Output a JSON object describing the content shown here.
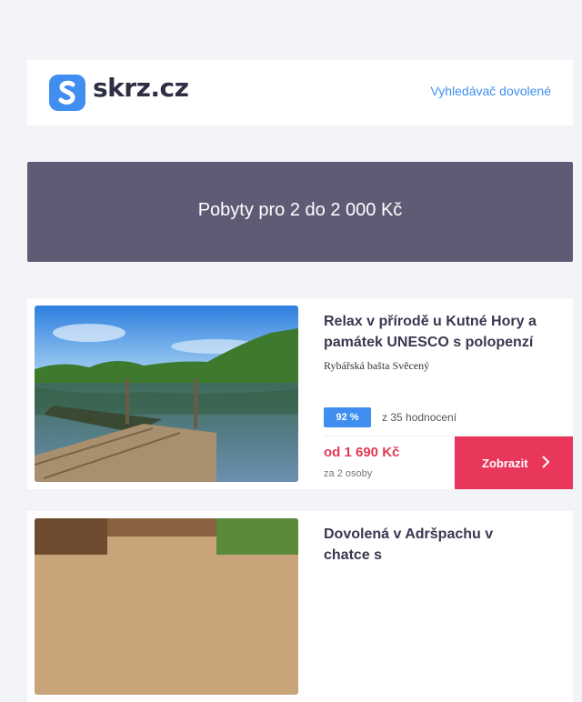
{
  "header": {
    "logo_text": "skrz.cz",
    "link_label": "Vyhledávač dovolené",
    "brand_color": "#3f8ef0",
    "logo_icon": "s-logo-icon"
  },
  "banner": {
    "title": "Pobyty pro 2 do 2 000 Kč",
    "background": "#605b75"
  },
  "offers": [
    {
      "title": "Relax v přírodě u Kutné Hory a památek UNESCO s polopenzí",
      "subtitle": "Rybářská bašta Svěcený",
      "rating": "92 %",
      "reviews": "z 35 hodnocení",
      "price": "od 1 690 Kč",
      "price_note": "za 2 osoby",
      "button_label": "Zobrazit",
      "image": "lake-pier-photo"
    },
    {
      "title": "Dovolená v Adršpachu v chatce s",
      "image": "cabin-terrace-photo"
    }
  ],
  "colors": {
    "accent": "#e8375a",
    "price": "#e23a53",
    "rating": "#3f8ef0"
  }
}
